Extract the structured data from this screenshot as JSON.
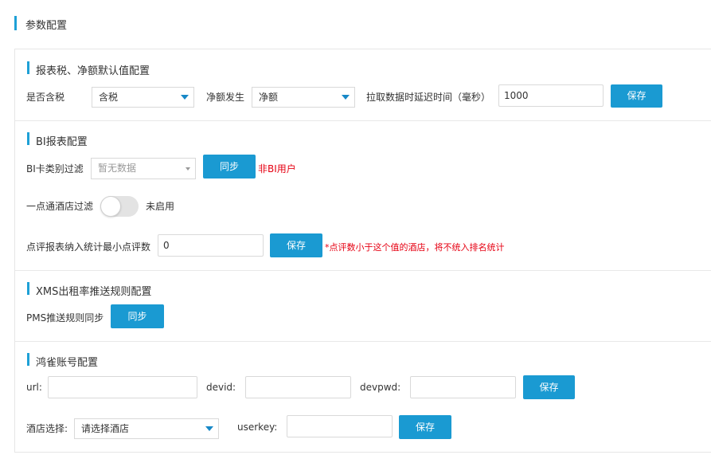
{
  "page": {
    "title": "参数配置"
  },
  "accent_color": "#1a9ad2",
  "sections": {
    "tax": {
      "title": "报表税、净额默认值配置",
      "tax_label": "是否含税",
      "tax_value": "含税",
      "net_label": "净额发生",
      "net_value": "净额",
      "delay_label": "拉取数据时延迟时间（毫秒）",
      "delay_value": "1000",
      "save_label": "保存"
    },
    "bi": {
      "title": "BI报表配置",
      "card_filter_label": "BI卡类别过滤",
      "card_filter_placeholder": "暂无数据",
      "sync_label": "同步",
      "non_bi_note": "非BI用户",
      "hotel_filter_label": "一点通酒店过滤",
      "hotel_filter_state": "未启用",
      "min_review_label": "点评报表纳入统计最小点评数",
      "min_review_value": "0",
      "save_label": "保存",
      "min_review_note": "*点评数小于这个值的酒店，将不统入排名统计"
    },
    "xms": {
      "title": "XMS出租率推送规则配置",
      "pms_label": "PMS推送规则同步",
      "sync_label": "同步"
    },
    "hq": {
      "title": "鸿雀账号配置",
      "url_label": "url:",
      "url_value": "",
      "devid_label": "devid:",
      "devid_value": "",
      "devpwd_label": "devpwd:",
      "devpwd_value": "",
      "save_label": "保存",
      "hotel_label": "酒店选择:",
      "hotel_value": "请选择酒店",
      "userkey_label": "userkey:",
      "userkey_value": "",
      "save2_label": "保存"
    }
  }
}
